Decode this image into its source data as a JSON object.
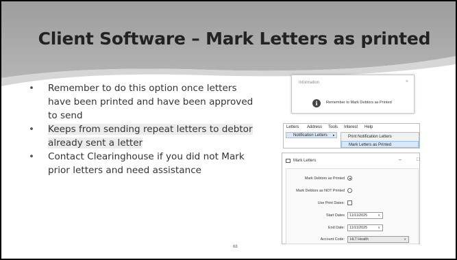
{
  "slide": {
    "title": "Client Software – Mark Letters as printed",
    "page_number": "68",
    "header_colors": {
      "dark": "#a3a3a3",
      "light": "#d6d6d6"
    }
  },
  "bullets": [
    "Remember to do this option once letters have been printed and have been approved to send",
    "Keeps from sending repeat letters to debtor already sent a letter",
    "Contact Clearinghouse if you did not Mark prior letters and need assistance"
  ],
  "info_dialog": {
    "title": "Information",
    "close": "×",
    "icon": "info-icon",
    "message": "Remember to Mark Debtors as Printed"
  },
  "menu": {
    "bar": [
      "Letters",
      "Address",
      "Tools",
      "Interest",
      "Help"
    ],
    "submenu_item": "Notification Letters",
    "submenu_arrow": "▸",
    "sub_items": [
      "Print Notification Letters",
      "Mark Letters as Printed"
    ]
  },
  "mark_letters_form": {
    "title": "Mark Letters",
    "minimize": "–",
    "maximize": "□",
    "labels": {
      "mark_printed": "Mark Debtors as Printed",
      "mark_not_printed": "Mark Debtors as NOT Printed",
      "use_print_dates": "Use Print Dates:",
      "start_dates": "Start Dates",
      "end_date": "End Date:",
      "account_code": "Account Code:"
    },
    "values": {
      "mark_printed_selected": true,
      "use_print_dates_checked": false,
      "start_date": "11/11/2025",
      "end_date": "11/11/2025",
      "account_code": "HLT Health"
    },
    "dropdown_arrow": "∨"
  }
}
